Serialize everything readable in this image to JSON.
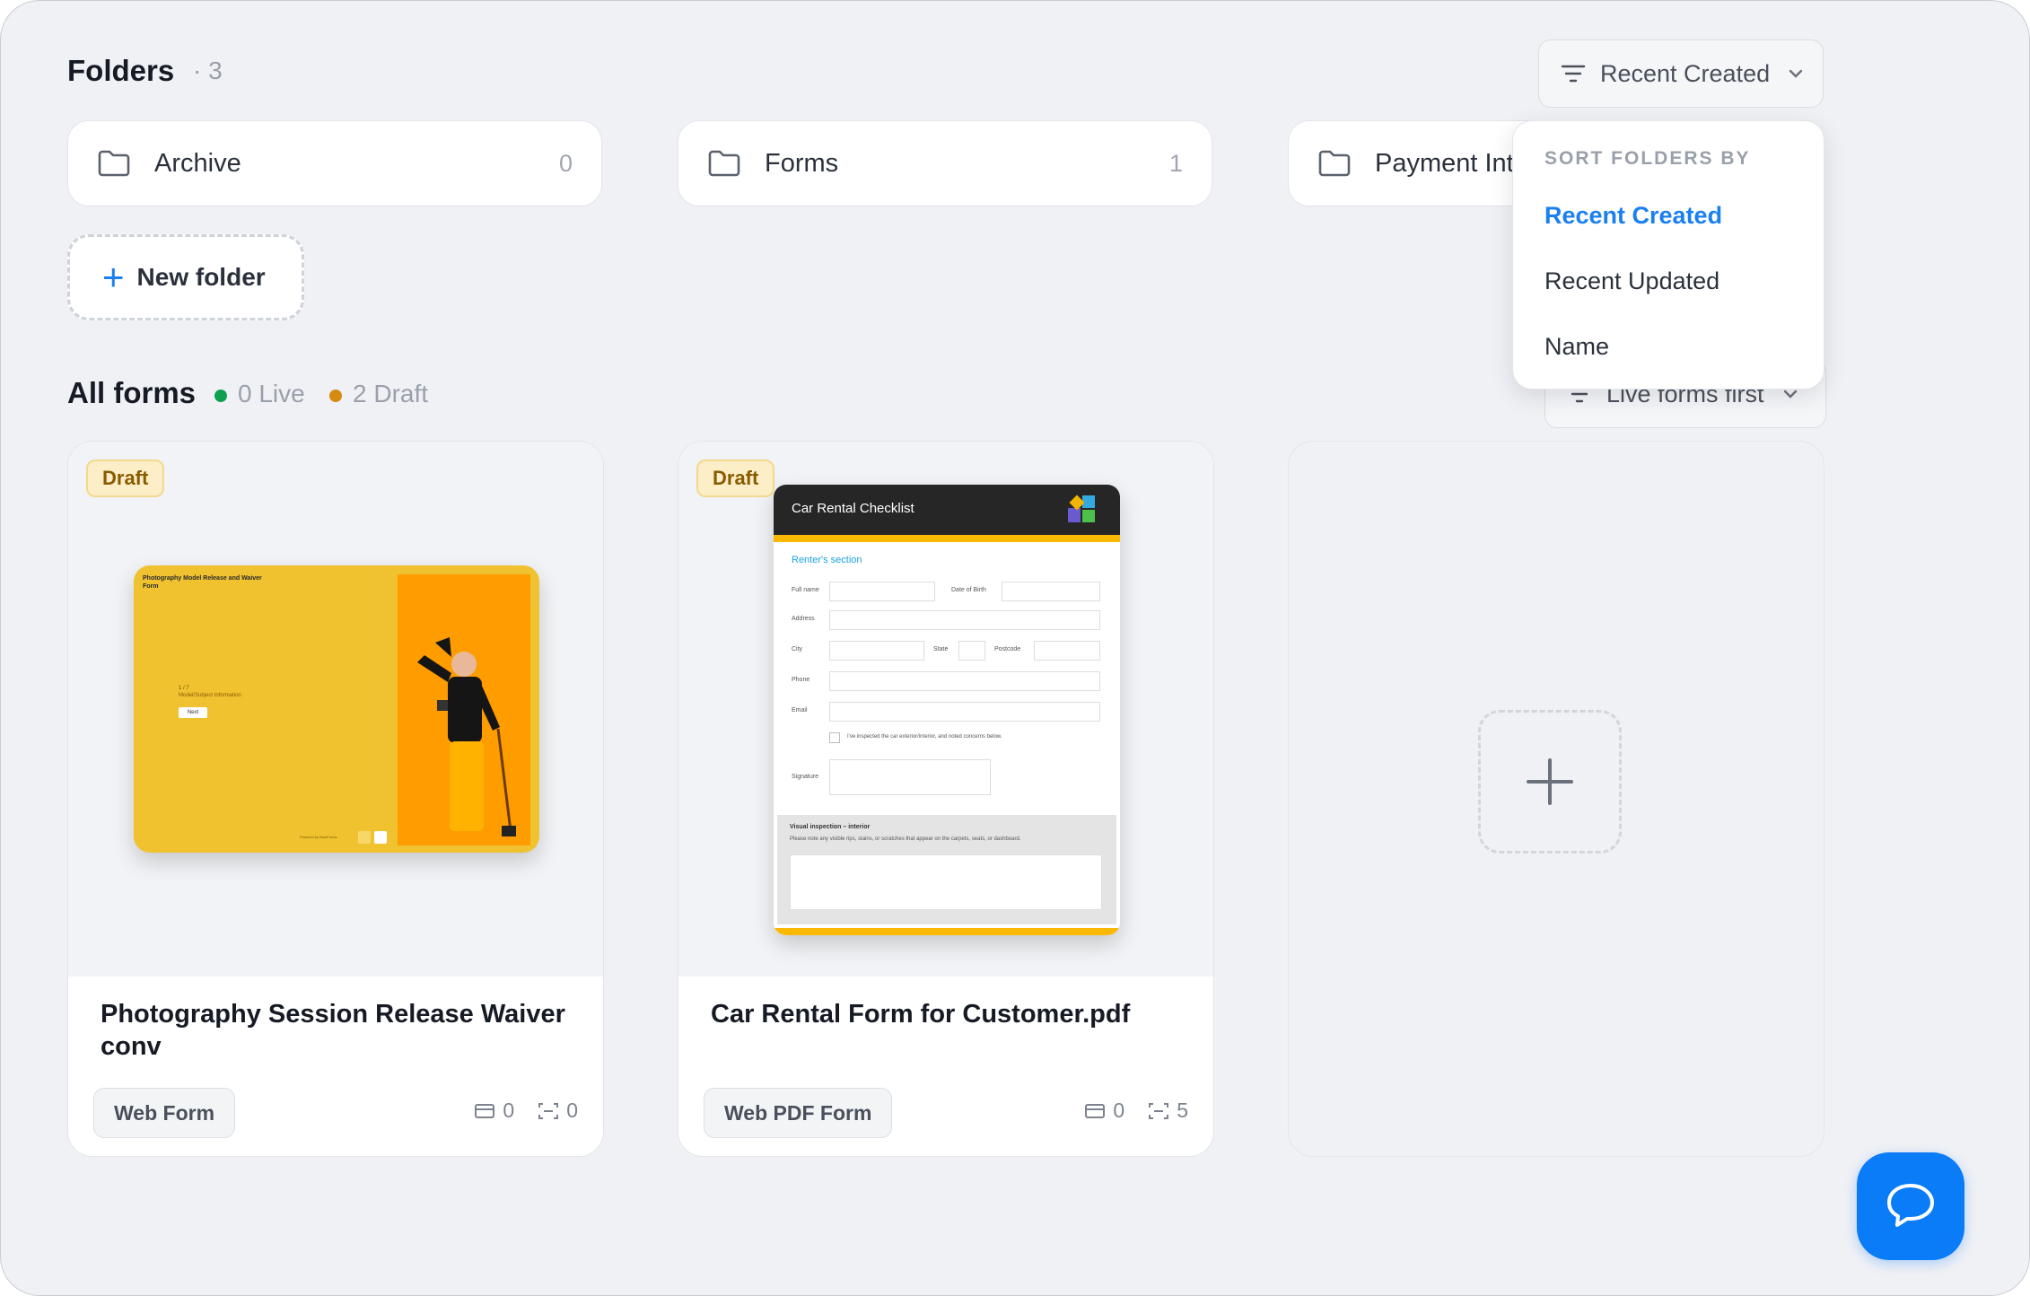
{
  "folders_header": {
    "title": "Folders",
    "count": "· 3"
  },
  "folders": [
    {
      "name": "Archive",
      "count": "0"
    },
    {
      "name": "Forms",
      "count": "1"
    },
    {
      "name": "Payment Int",
      "count": ""
    }
  ],
  "new_folder": {
    "label": "New folder"
  },
  "folder_sort": {
    "label": "Recent Created"
  },
  "sort_menu": {
    "header": "SORT FOLDERS BY",
    "options": [
      "Recent Created",
      "Recent Updated",
      "Name"
    ],
    "selected": "Recent Created"
  },
  "forms_header": {
    "title": "All forms",
    "live": "0 Live",
    "draft": "2 Draft"
  },
  "forms_sort": {
    "label": "Live forms first"
  },
  "cards": [
    {
      "badge": "Draft",
      "title": "Photography Session Release Waiver conv",
      "type": "Web Form",
      "stat_a": "0",
      "stat_b": "0",
      "preview": {
        "heading": "Photography Model Release and Waiver Form",
        "step": "1 / 7",
        "step_label": "Model/Subject Information",
        "next": "Next",
        "powered": "Powered by BoloForms"
      }
    },
    {
      "badge": "Draft",
      "title": "Car Rental Form for Customer.pdf",
      "type": "Web PDF Form",
      "stat_a": "0",
      "stat_b": "5",
      "preview": {
        "heading": "Car Rental Checklist",
        "section": "Renter's section",
        "full_name": "Full name",
        "dob": "Date of Birth",
        "address": "Address",
        "city": "City",
        "state": "State",
        "postcode": "Postcode",
        "phone": "Phone",
        "email": "Email",
        "checkbox": "I've inspected the car exterior/interior, and noted concerns below.",
        "signature": "Signature",
        "visual": "Visual inspection – interior",
        "visual_note": "Please note any visible rips, stains, or scratches that appear on the carpets, seats, or dashboard."
      }
    }
  ],
  "colors": {
    "accent": "#1a7ff0",
    "live": "#10a050",
    "draft": "#d58a10",
    "draft_badge_bg": "#fcefc8"
  }
}
